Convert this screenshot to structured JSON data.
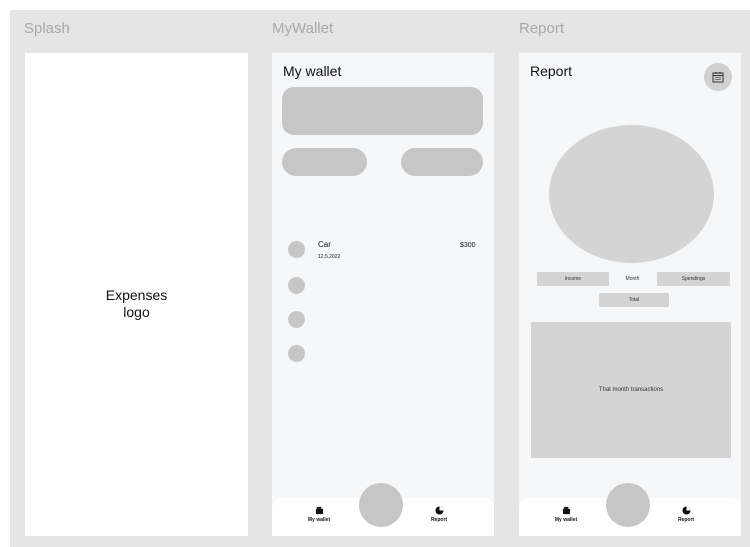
{
  "frames": {
    "splash": {
      "label": "Splash",
      "center_text": "Expenses\nlogo"
    },
    "wallet": {
      "label": "MyWallet",
      "title": "My wallet",
      "transaction": {
        "name": "Car",
        "date": "12.5.2022",
        "amount": "$300"
      },
      "tabs": {
        "left": "My wallet",
        "right": "Report"
      }
    },
    "report": {
      "label": "Report",
      "title": "Report",
      "filters": {
        "income": "Income",
        "month": "Month",
        "spendings": "Spendings",
        "total": "Total"
      },
      "transactions_placeholder": "That month transactions",
      "tabs": {
        "left": "My wallet",
        "right": "Report"
      }
    }
  },
  "colors": {
    "canvas": "#e5e5e5",
    "placeholder": "#c6c6c6",
    "phone_bg": "#f6f7f9"
  },
  "icons": [
    "wallet-icon",
    "pie-chart-icon",
    "calendar-icon"
  ]
}
